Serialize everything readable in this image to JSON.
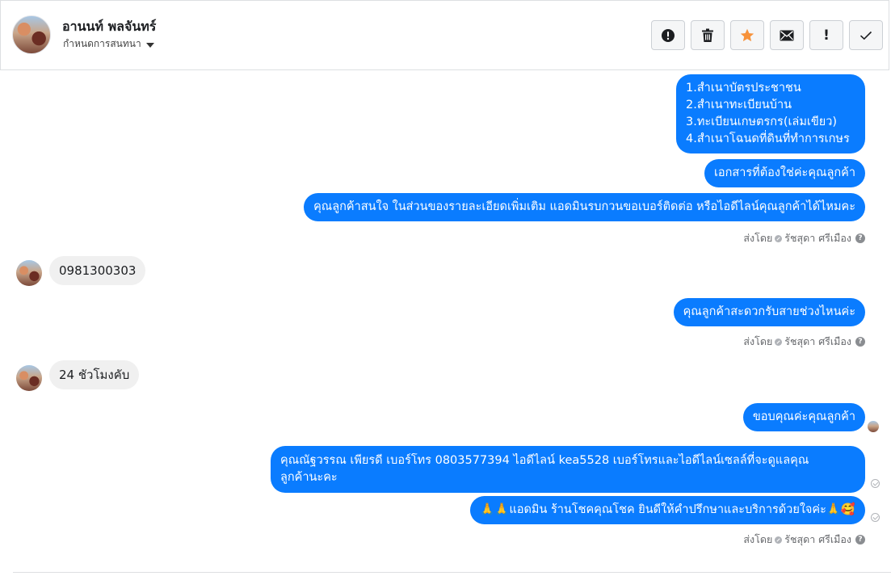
{
  "header": {
    "contact_name": "อานนท์ พลจันทร์",
    "assign_label": "กำหนดการสนทนา",
    "toolbar": [
      {
        "name": "alert-icon"
      },
      {
        "name": "trash-icon"
      },
      {
        "name": "star-icon",
        "color": "#f7923a"
      },
      {
        "name": "mail-icon"
      },
      {
        "name": "exclamation-icon",
        "text": "!"
      },
      {
        "name": "check-icon"
      }
    ]
  },
  "messages": {
    "m1_lines": [
      "1.สำเนาบัตรประชาชน",
      "2.สำเนาทะเบียนบ้าน",
      "3.ทะเบียนเกษตรกร(เล่มเขียว)",
      "4.สำเนาโฉนดที่ดินที่ทำการเกษร"
    ],
    "m2": "เอกสารที่ต้องใช่ค่ะคุณลูกค้า",
    "m3": "คุณลูกค้าสนใจ ในส่วนของรายละเอียดเพิ่มเติม แอดมินรบกวนขอเบอร์ติดต่อ หรือไอดีไลน์คุณลูกค้าได้ไหมคะ",
    "in1": "0981300303",
    "m4": "คุณลูกค้าสะดวกรับสายช่วงไหนค่ะ",
    "in2": "24 ชัวโมงคับ",
    "m5": "ขอบคุณค่ะคุณลูกค้า",
    "m6_line1": "คุณณัฐวรรณ เพียรดี        เบอร์โทร 0803577394  ไอดีไลน์ kea5528   เบอร์โทรและไอดีไลน์เซลล์ที่จะดูแลคุณ",
    "m6_line2": "ลูกค้านะคะ",
    "m7": "🙏🙏แอดมิน ร้านโชคคุณโชค ยินดีให้คำปรึกษาและบริการด้วยใจค่ะ🙏🥰"
  },
  "meta": {
    "sent_by": "ส่งโดย",
    "agent": "รัชสุดา ศรีเมือง",
    "help": "?"
  },
  "colors": {
    "outgoing_bubble": "#0a7cff",
    "incoming_bubble": "#f0f0f0"
  }
}
